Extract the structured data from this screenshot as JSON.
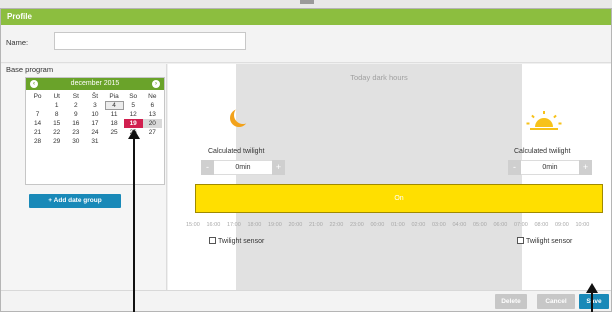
{
  "window": {
    "title": "Profile"
  },
  "name_field": {
    "label": "Name:",
    "value": "",
    "placeholder": ""
  },
  "base_program": {
    "label": "Base program"
  },
  "calendar": {
    "month_label": "december 2015",
    "prev_icon": "chevron-left-icon",
    "next_icon": "chevron-right-icon",
    "weekdays": [
      "Po",
      "Ut",
      "St",
      "Št",
      "Pia",
      "So",
      "Ne"
    ],
    "weeks": [
      [
        "",
        "1",
        "2",
        "3",
        "4",
        "5",
        "6"
      ],
      [
        "7",
        "8",
        "9",
        "10",
        "11",
        "12",
        "13"
      ],
      [
        "14",
        "15",
        "16",
        "17",
        "18",
        "19",
        "20"
      ],
      [
        "21",
        "22",
        "23",
        "24",
        "25",
        "26",
        "27"
      ],
      [
        "28",
        "29",
        "30",
        "31",
        "",
        "",
        ""
      ]
    ],
    "today": "4",
    "selected": "19",
    "highlighted": "20",
    "selected_color": "#d11f4f"
  },
  "add_date_group": {
    "label": "+ Add date group"
  },
  "schedule": {
    "dark_title": "Today dark hours",
    "left": {
      "icon": "moon-icon",
      "label": "Calculated twilight",
      "value": "0min",
      "minus": "-",
      "plus": "+"
    },
    "right": {
      "icon": "sunrise-icon",
      "label": "Calculated twilight",
      "value": "0min",
      "minus": "-",
      "plus": "+"
    },
    "on_label": "On",
    "timeline": [
      "15:00",
      "16:00",
      "17:00",
      "18:00",
      "19:00",
      "20:00",
      "21:00",
      "22:00",
      "23:00",
      "00:00",
      "01:00",
      "02:00",
      "03:00",
      "04:00",
      "05:00",
      "06:00",
      "07:00",
      "08:00",
      "09:00",
      "10:00"
    ],
    "sensor_left": "Twilight sensor",
    "sensor_right": "Twilight sensor"
  },
  "footer": {
    "delete_label": "Delete",
    "cancel_label": "Cancel",
    "save_label": "Save"
  },
  "colors": {
    "header": "#8cbe3f",
    "accent": "#1989b8",
    "on_bar": "#ffdf00",
    "moon": "#f2a21b",
    "sun": "#f7c21a"
  }
}
